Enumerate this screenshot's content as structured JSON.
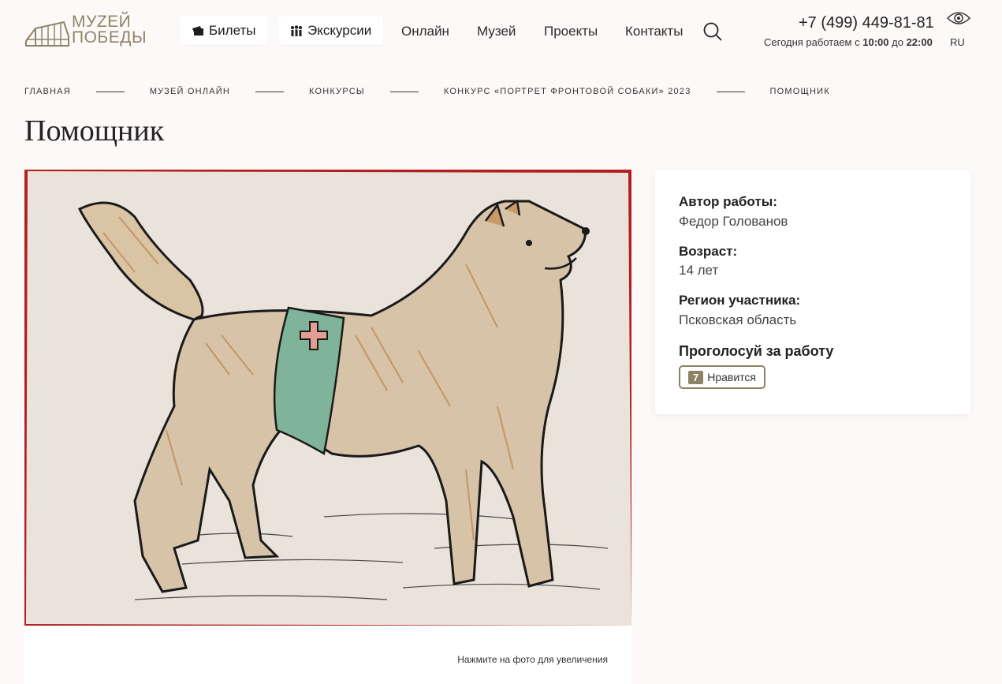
{
  "header": {
    "logo_line1": "МУZЕЙ",
    "logo_line2": "ПОБЕДЫ",
    "tickets_label": "Билеты",
    "excursions_label": "Экскурсии",
    "nav": [
      "Онлайн",
      "Музей",
      "Проекты",
      "Контакты"
    ],
    "phone": "+7 (499) 449-81-81",
    "hours_prefix": "Сегодня работаем с",
    "hours_from": "10:00",
    "hours_mid": "до",
    "hours_to": "22:00",
    "lang": "RU"
  },
  "breadcrumb": [
    "Главная",
    "Музей онлайн",
    "Конкурсы",
    "Конкурс «Портрет фронтовой собаки» 2023",
    "Помощник"
  ],
  "page_title": "Помощник",
  "artwork": {
    "hint": "Нажмите на фото для увеличения"
  },
  "info": {
    "author_label": "Автор работы",
    "author_value": "Федор Голованов",
    "age_label": "Возраст",
    "age_value": "14 лет",
    "region_label": "Регион участника",
    "region_value": "Псковская область",
    "vote_title": "Проголосуй за работу",
    "likes_count": "7",
    "like_label": "Нравится"
  },
  "colors": {
    "background": "#fdf9f8",
    "accent": "#8e8165",
    "logo": "#8e8468"
  }
}
